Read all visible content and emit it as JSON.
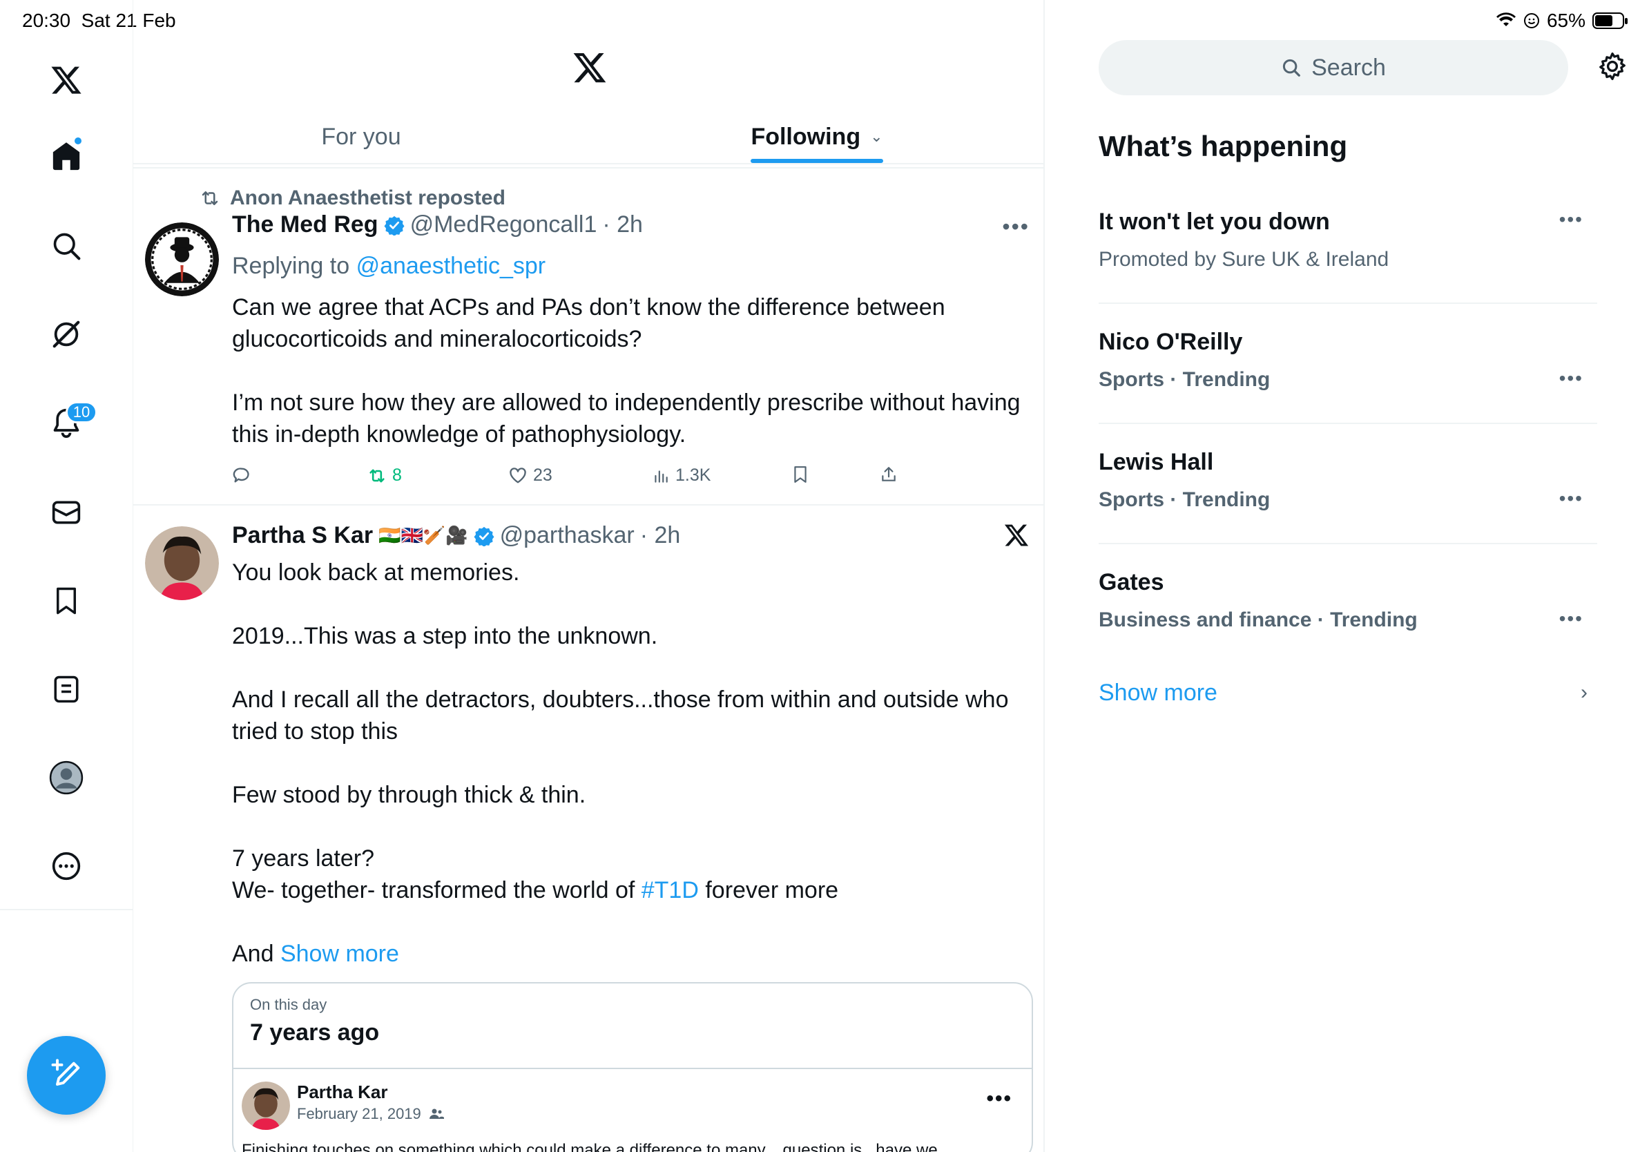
{
  "status_bar": {
    "time": "20:30",
    "date": "Sat 21 Feb",
    "battery": "65%",
    "battery_level": 0.65
  },
  "left_nav": {
    "items": [
      {
        "name": "home",
        "icon": "home-icon"
      },
      {
        "name": "explore",
        "icon": "search-icon"
      },
      {
        "name": "grok",
        "icon": "grok-icon"
      },
      {
        "name": "notifications",
        "icon": "bell-icon"
      },
      {
        "name": "messages",
        "icon": "mail-icon"
      },
      {
        "name": "bookmarks",
        "icon": "bookmark-icon"
      },
      {
        "name": "lists",
        "icon": "list-icon"
      },
      {
        "name": "profile",
        "icon": "profile-icon"
      },
      {
        "name": "more",
        "icon": "more-circle-icon"
      }
    ],
    "notification_badge": "10",
    "compose_icon": "compose-icon"
  },
  "main": {
    "tabs": [
      {
        "label": "For you",
        "active": false
      },
      {
        "label": "Following",
        "active": true
      }
    ],
    "posts": [
      {
        "repost_label": "Anon Anaesthetist reposted",
        "name": "The Med Reg",
        "verified": true,
        "handle": "@MedRegoncall1",
        "time": "· 2h",
        "replying_prefix": "Replying to",
        "replying_to": "@anaesthetic_spr",
        "paragraphs": [
          "Can we agree that ACPs and PAs don’t know the difference between glucocorticoids and mineralocorticoids?",
          "I’m not sure how they are allowed to independently prescribe without having this in-depth knowledge of pathophysiology."
        ],
        "stats": {
          "replies": "",
          "reposts": "8",
          "likes": "23",
          "views": "1.3K"
        }
      },
      {
        "name": "Partha S Kar",
        "flags": "🇮🇳🇬🇧🏏🎥",
        "verified": true,
        "handle": "@parthaskar",
        "time": "· 2h",
        "line1": "You look back at memories.",
        "line2": "2019...This was a step into the unknown.",
        "line3": "And I recall all the detractors, doubters...those from within and outside who tried to stop this",
        "line4": "Few stood by through thick & thin.",
        "line5a": "7 years later?",
        "line5b_pre": "We- together- transformed the world of",
        "hashtag": "#T1D",
        "line5b_post": "forever more",
        "line6_pre": "And",
        "show_more": "Show more",
        "card": {
          "small_label": "On this day",
          "title": "7 years ago",
          "author": "Partha Kar",
          "date": "February 21, 2019",
          "snippet": "Finishing touches on something which could make a difference to many... question is...have we"
        }
      }
    ]
  },
  "sidebar": {
    "search_placeholder": "Search",
    "section_title": "What’s happening",
    "trends": [
      {
        "title": "It won't let you down",
        "subtitle": "Promoted by Sure UK & Ireland",
        "bold_sub": false
      },
      {
        "title": "Nico O'Reilly",
        "subtitle": "Sports · Trending",
        "bold_sub": true
      },
      {
        "title": "Lewis Hall",
        "subtitle": "Sports · Trending",
        "bold_sub": true
      },
      {
        "title": "Gates",
        "subtitle": "Business and finance · Trending",
        "bold_sub": true
      }
    ],
    "show_more": "Show more"
  },
  "colors": {
    "accent": "#1d9bf0",
    "repost_green": "#00ba7c",
    "muted_text": "#536471",
    "border": "#eff3f4"
  }
}
